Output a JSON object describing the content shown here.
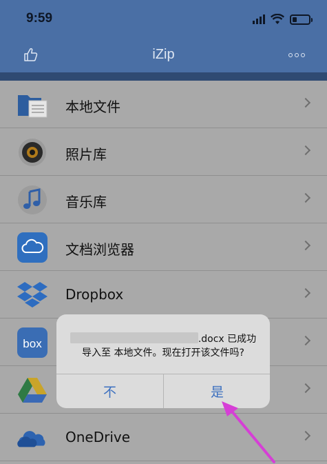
{
  "status": {
    "time": "9:59"
  },
  "navbar": {
    "title": "iZip"
  },
  "list": [
    {
      "label": "本地文件",
      "icon": "folder-icon"
    },
    {
      "label": "照片库",
      "icon": "camera-icon"
    },
    {
      "label": "音乐库",
      "icon": "music-note-icon"
    },
    {
      "label": "文档浏览器",
      "icon": "cloud-icon"
    },
    {
      "label": "Dropbox",
      "icon": "dropbox-icon"
    },
    {
      "label": "",
      "icon": "box-icon"
    },
    {
      "label": "",
      "icon": "google-drive-icon"
    },
    {
      "label": "OneDrive",
      "icon": "onedrive-icon"
    }
  ],
  "dialog": {
    "message_line1_suffix": ".docx 已成功",
    "message_line2": "导入至 本地文件。现在打开该文件吗?",
    "no_label": "不",
    "yes_label": "是"
  },
  "colors": {
    "navbar": "#4a6fa5",
    "accent": "#3b6fbf",
    "annotation_arrow": "#d63fd6"
  }
}
